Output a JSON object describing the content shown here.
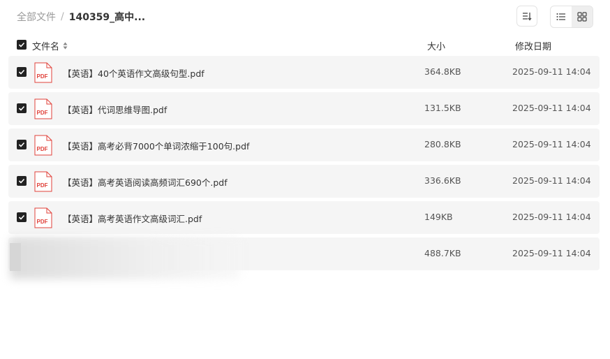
{
  "breadcrumb": {
    "root": "全部文件",
    "separator": "/",
    "current": "140359_高中..."
  },
  "table": {
    "columns": {
      "name": "文件名",
      "size": "大小",
      "date": "修改日期"
    },
    "rows": [
      {
        "name": "【英语】40个英语作文高级句型.pdf",
        "size": "364.8KB",
        "date": "2025-09-11 14:04",
        "checked": true,
        "icon_label": "PDF"
      },
      {
        "name": "【英语】代词思维导图.pdf",
        "size": "131.5KB",
        "date": "2025-09-11 14:04",
        "checked": true,
        "icon_label": "PDF"
      },
      {
        "name": "【英语】高考必背7000个单词浓缩于100句.pdf",
        "size": "280.8KB",
        "date": "2025-09-11 14:04",
        "checked": true,
        "icon_label": "PDF"
      },
      {
        "name": "【英语】高考英语阅读高频词汇690个.pdf",
        "size": "336.6KB",
        "date": "2025-09-11 14:04",
        "checked": true,
        "icon_label": "PDF"
      },
      {
        "name": "【英语】高考英语作文高级词汇.pdf",
        "size": "149KB",
        "date": "2025-09-11 14:04",
        "checked": true,
        "icon_label": "PDF"
      },
      {
        "name": "",
        "size": "488.7KB",
        "date": "2025-09-11 14:04",
        "checked": true,
        "icon_label": ""
      }
    ]
  },
  "colors": {
    "row_bg": "#f5f5f5",
    "checkbox": "#222222",
    "pdf_red": "#e0413a"
  },
  "icons": {
    "sort": "sort-descending-icon",
    "list": "list-view-icon",
    "grid": "grid-view-icon",
    "file": "pdf-file-icon"
  }
}
